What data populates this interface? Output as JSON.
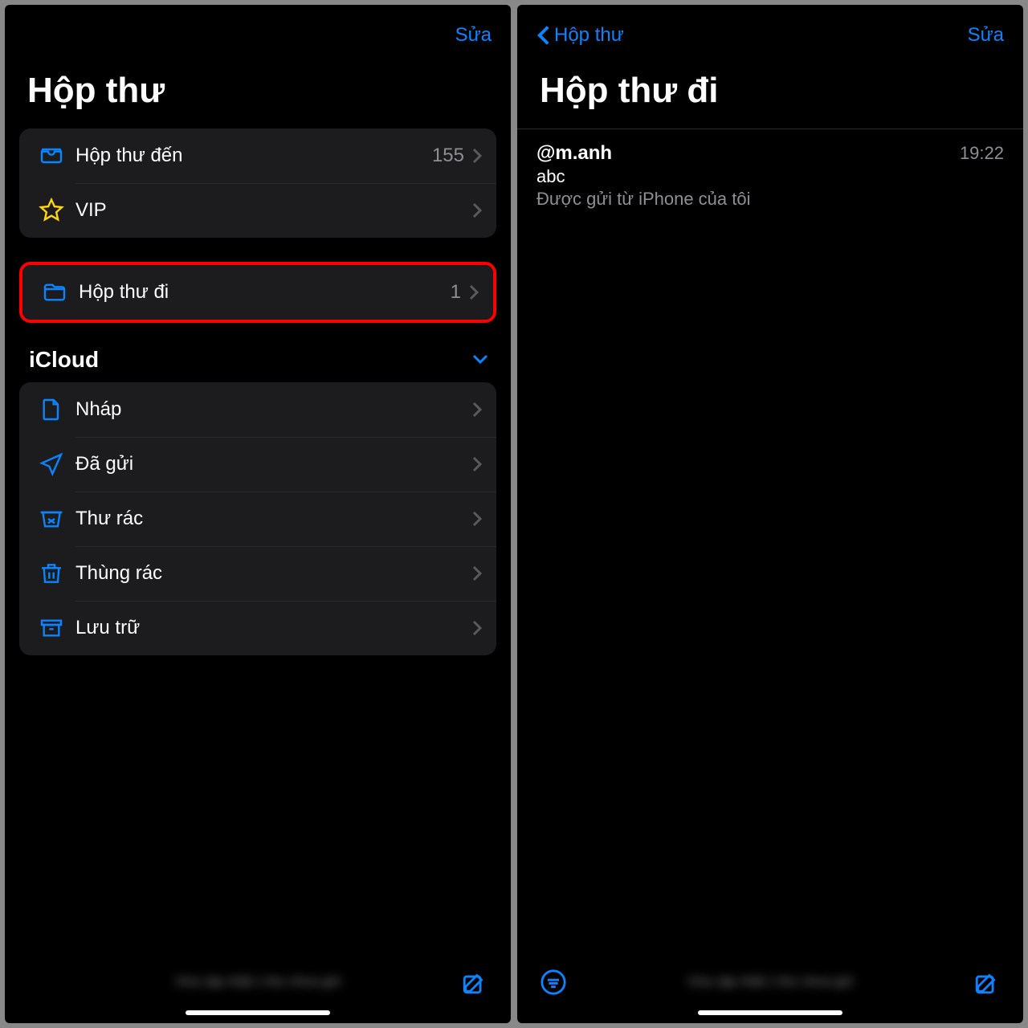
{
  "left": {
    "nav_edit": "Sửa",
    "title": "Hộp thư",
    "inbox": {
      "label": "Hộp thư đến",
      "count": "155"
    },
    "vip": {
      "label": "VIP"
    },
    "outbox": {
      "label": "Hộp thư đi",
      "count": "1"
    },
    "icloud_header": "iCloud",
    "drafts": {
      "label": "Nháp"
    },
    "sent": {
      "label": "Đã gửi"
    },
    "junk": {
      "label": "Thư rác"
    },
    "trash": {
      "label": "Thùng rác"
    },
    "archive": {
      "label": "Lưu trữ"
    },
    "toolbar_status": "Vừa cập nhật\n1 thư chưa gửi"
  },
  "right": {
    "nav_back": "Hộp thư",
    "nav_edit": "Sửa",
    "title": "Hộp thư đi",
    "message": {
      "sender": "@m.anh",
      "time": "19:22",
      "subject": "abc",
      "preview": "Được gửi từ iPhone của tôi"
    },
    "toolbar_status": "Vừa cập nhật\n1 thư chưa gửi"
  }
}
